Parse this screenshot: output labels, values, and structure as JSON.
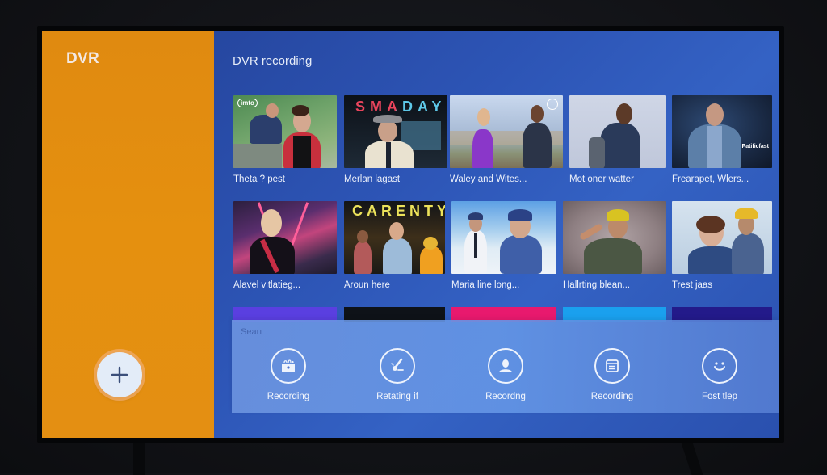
{
  "sidebar": {
    "title": "DVR",
    "add_button_icon": "plus-icon",
    "color": "#e38d10"
  },
  "header": {
    "title": "DVR recording",
    "control_icons": [
      "chat-bubble-icon",
      "chevron-down-icon"
    ]
  },
  "theme": {
    "main_background": "#2d55b6",
    "action_bar": "#6a96e2",
    "text": "#eef2fb"
  },
  "recordings": {
    "rows": [
      [
        {
          "title": "Theta ? pest",
          "badge": "imto"
        },
        {
          "title": "Merlan lagast",
          "overlay": "SMADAY"
        },
        {
          "title": "Waley and Wites..."
        },
        {
          "title": "Mot oner watter"
        },
        {
          "title": "Frearapet, Wlers...",
          "badge": "Patificfast"
        }
      ],
      [
        {
          "title": "Alavel vitlatieg..."
        },
        {
          "title": "Aroun here",
          "overlay": "CARENTY"
        },
        {
          "title": "Maria line long..."
        },
        {
          "title": "Hallrting blean..."
        },
        {
          "title": "Trest jaas"
        }
      ]
    ]
  },
  "action_bar": {
    "search_label": "Searı",
    "actions": [
      {
        "label": "Recording",
        "icon": "gift-box-icon"
      },
      {
        "label": "Retating if",
        "icon": "edit-pen-icon"
      },
      {
        "label": "Recordng",
        "icon": "user-avatar-icon"
      },
      {
        "label": "Recording",
        "icon": "list-icon"
      },
      {
        "label": "Fost tlep",
        "icon": "smiley-icon"
      }
    ]
  }
}
